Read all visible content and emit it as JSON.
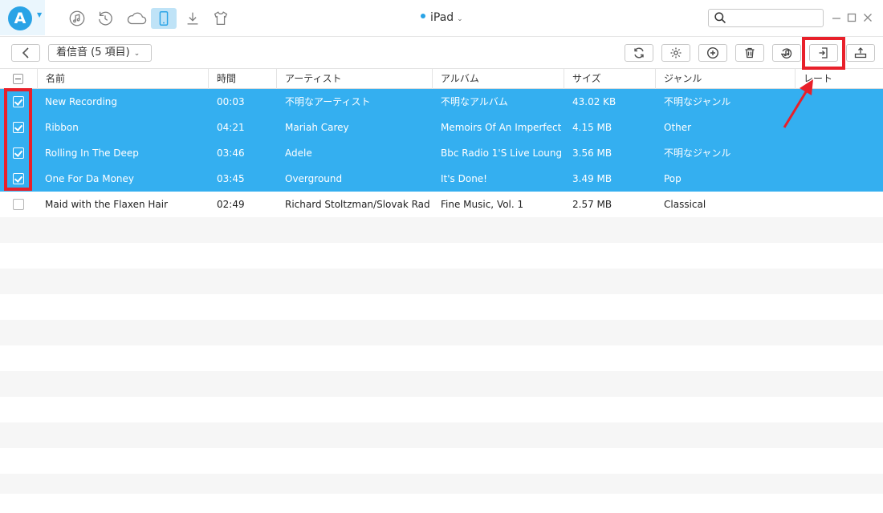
{
  "device": {
    "name": "iPad"
  },
  "category": {
    "label": "着信音 (5 項目)"
  },
  "columns": [
    "名前",
    "時間",
    "アーティスト",
    "アルバム",
    "サイズ",
    "ジャンル",
    "レート"
  ],
  "rows": [
    {
      "selected": true,
      "name": "New Recording",
      "time": "00:03",
      "artist": "不明なアーティスト",
      "album": "不明なアルバム",
      "size": "43.02 KB",
      "genre": "不明なジャンル"
    },
    {
      "selected": true,
      "name": "Ribbon",
      "time": "04:21",
      "artist": "Mariah Carey",
      "album": "Memoirs Of An Imperfect..",
      "size": "4.15 MB",
      "genre": "Other"
    },
    {
      "selected": true,
      "name": "Rolling In The Deep",
      "time": "03:46",
      "artist": "Adele",
      "album": "Bbc Radio 1'S Live Loung...",
      "size": "3.56 MB",
      "genre": "不明なジャンル"
    },
    {
      "selected": true,
      "name": "One For Da Money",
      "time": "03:45",
      "artist": "Overground",
      "album": "It's Done!",
      "size": "3.49 MB",
      "genre": "Pop"
    },
    {
      "selected": false,
      "name": "Maid with the Flaxen Hair",
      "time": "02:49",
      "artist": "Richard Stoltzman/Slovak Radi...",
      "album": "Fine Music, Vol. 1",
      "size": "2.57 MB",
      "genre": "Classical"
    }
  ],
  "icons": {
    "nav": [
      "music-icon",
      "restore-icon",
      "cloud-icon",
      "device-icon",
      "download-icon",
      "shirt-icon"
    ],
    "actions": [
      "refresh-icon",
      "settings-icon",
      "add-icon",
      "delete-icon",
      "to-itunes-icon",
      "to-computer-icon",
      "to-device-icon"
    ]
  },
  "colors": {
    "accent": "#29a3e6",
    "selection": "#34aff0",
    "highlight": "#e8202a"
  }
}
